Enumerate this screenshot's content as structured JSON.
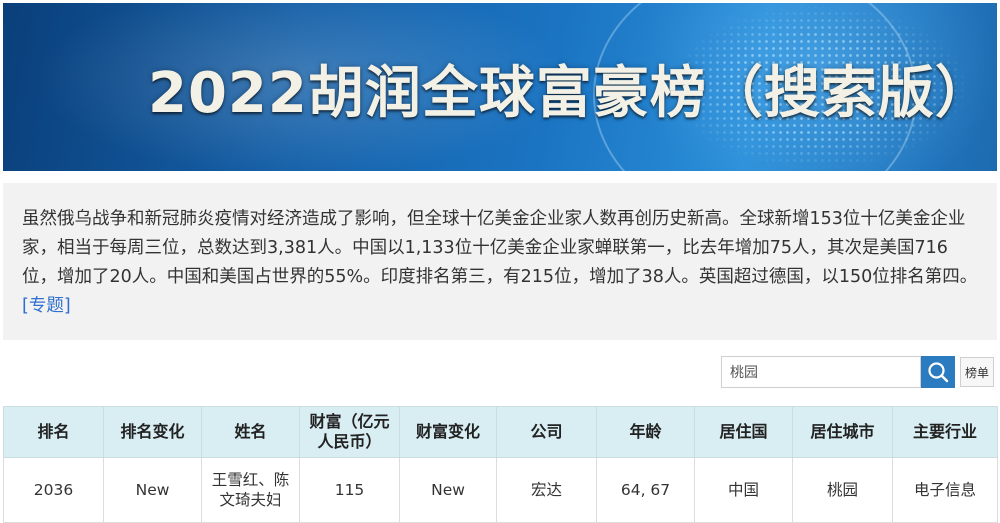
{
  "banner": {
    "title": "2022胡润全球富豪榜（搜索版）"
  },
  "intro": {
    "text": "虽然俄乌战争和新冠肺炎疫情对经济造成了影响，但全球十亿美金企业家人数再创历史新高。全球新增153位十亿美金企业家，相当于每周三位，总数达到3,381人。中国以1,133位十亿美金企业家蝉联第一，比去年增加75人，其次是美国716位，增加了20人。中国和美国占世界的55%。印度排名第三，有215位，增加了38人。英国超过德国，以150位排名第四。",
    "link_label": "[专题]"
  },
  "search": {
    "value": "桃园",
    "button_icon": "search-icon",
    "list_button_label": "榜单"
  },
  "table": {
    "headers": [
      "排名",
      "排名变化",
      "姓名",
      "财富（亿元人民币）",
      "财富变化",
      "公司",
      "年龄",
      "居住国",
      "居住城市",
      "主要行业"
    ],
    "rows": [
      [
        "2036",
        "New",
        "王雪红、陈文琦夫妇",
        "115",
        "New",
        "宏达",
        "64, 67",
        "中国",
        "桃园",
        "电子信息"
      ]
    ]
  },
  "colors": {
    "header_bg": "#d9eef3",
    "search_button": "#2a7bc0",
    "link": "#2f6fd0",
    "intro_bg": "#f2f2f2"
  }
}
